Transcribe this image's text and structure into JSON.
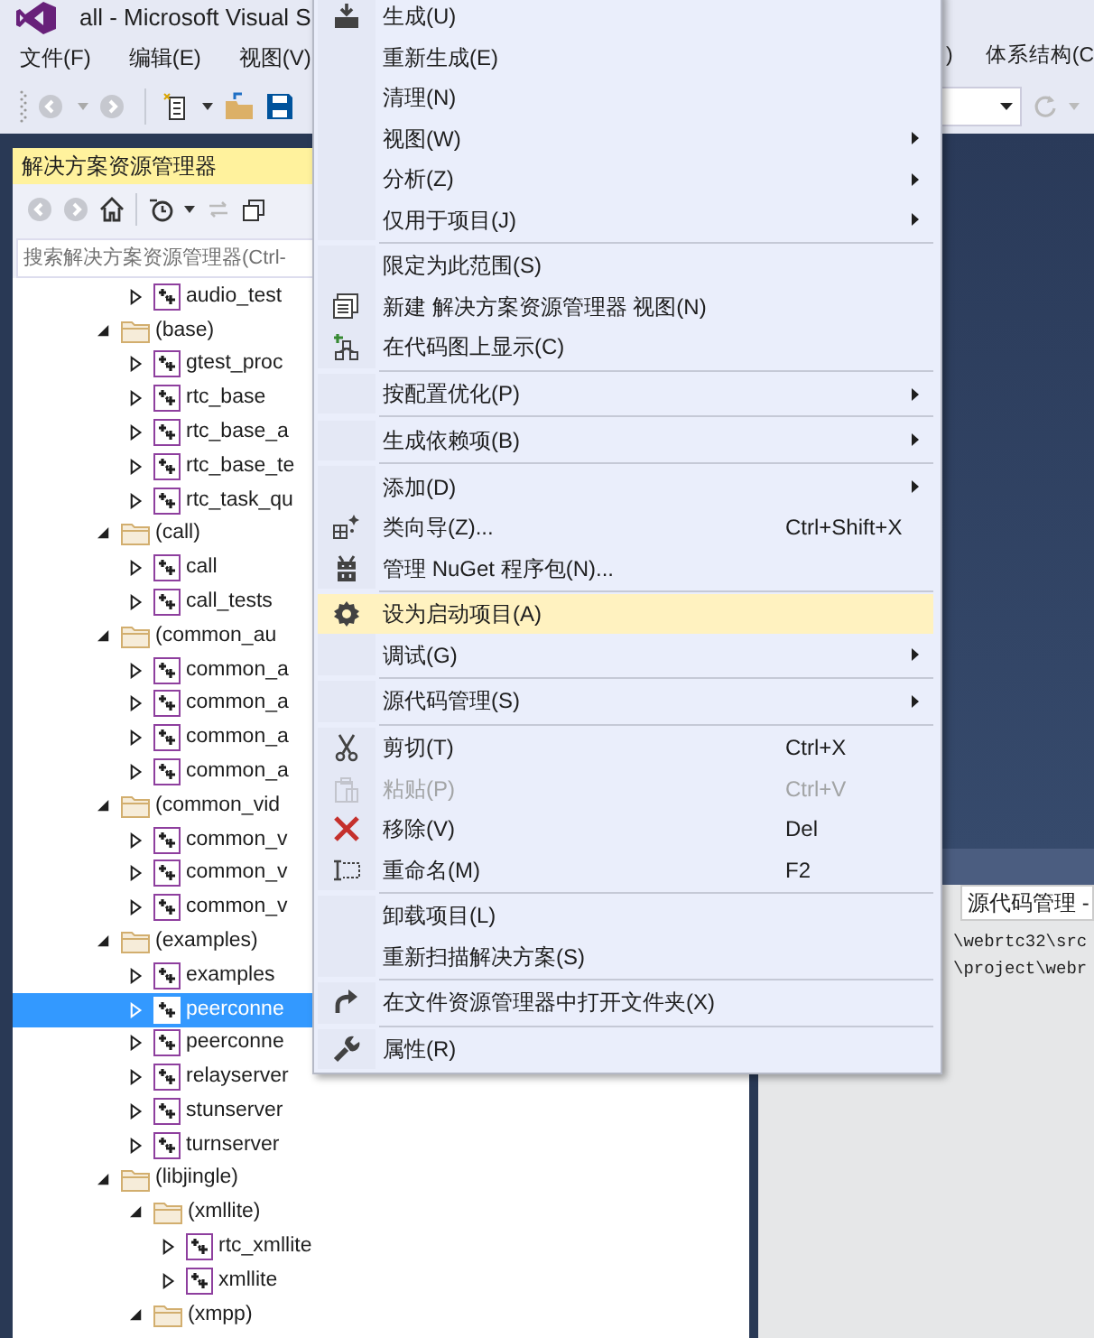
{
  "window": {
    "title": "all - Microsoft Visual S"
  },
  "menu_bar": {
    "items": [
      "文件(F)",
      "编辑(E)",
      "视图(V)"
    ],
    "right_items": [
      ")",
      "体系结构(C"
    ]
  },
  "solution_explorer": {
    "title": "解决方案资源管理器",
    "search": {
      "placeholder": "搜索解决方案资源管理器(Ctrl-"
    },
    "tree": {
      "continued": [
        {
          "label": "audio_test",
          "kind": "project",
          "expanded": false,
          "selected": false
        }
      ],
      "items": [
        {
          "label": "(base)",
          "kind": "folder",
          "expanded": true,
          "selected": false,
          "children": [
            {
              "label": "gtest_proc",
              "kind": "project",
              "expanded": false,
              "selected": false
            },
            {
              "label": "rtc_base",
              "kind": "project",
              "expanded": false,
              "selected": false
            },
            {
              "label": "rtc_base_a",
              "kind": "project",
              "expanded": false,
              "selected": false
            },
            {
              "label": "rtc_base_te",
              "kind": "project",
              "expanded": false,
              "selected": false
            },
            {
              "label": "rtc_task_qu",
              "kind": "project",
              "expanded": false,
              "selected": false
            }
          ]
        },
        {
          "label": "(call)",
          "kind": "folder",
          "expanded": true,
          "selected": false,
          "children": [
            {
              "label": "call",
              "kind": "project",
              "expanded": false,
              "selected": false
            },
            {
              "label": "call_tests",
              "kind": "project",
              "expanded": false,
              "selected": false
            }
          ]
        },
        {
          "label": "(common_au",
          "kind": "folder",
          "expanded": true,
          "selected": false,
          "children": [
            {
              "label": "common_a",
              "kind": "project",
              "expanded": false,
              "selected": false
            },
            {
              "label": "common_a",
              "kind": "project",
              "expanded": false,
              "selected": false
            },
            {
              "label": "common_a",
              "kind": "project",
              "expanded": false,
              "selected": false
            },
            {
              "label": "common_a",
              "kind": "project",
              "expanded": false,
              "selected": false
            }
          ]
        },
        {
          "label": "(common_vid",
          "kind": "folder",
          "expanded": true,
          "selected": false,
          "children": [
            {
              "label": "common_v",
              "kind": "project",
              "expanded": false,
              "selected": false
            },
            {
              "label": "common_v",
              "kind": "project",
              "expanded": false,
              "selected": false
            },
            {
              "label": "common_v",
              "kind": "project",
              "expanded": false,
              "selected": false
            }
          ]
        },
        {
          "label": "(examples)",
          "kind": "folder",
          "expanded": true,
          "selected": false,
          "children": [
            {
              "label": "examples",
              "kind": "project",
              "expanded": false,
              "selected": false
            },
            {
              "label": "peerconne",
              "kind": "project",
              "expanded": false,
              "selected": true
            },
            {
              "label": "peerconne",
              "kind": "project",
              "expanded": false,
              "selected": false
            },
            {
              "label": "relayserver",
              "kind": "project",
              "expanded": false,
              "selected": false
            },
            {
              "label": "stunserver",
              "kind": "project",
              "expanded": false,
              "selected": false
            },
            {
              "label": "turnserver",
              "kind": "project",
              "expanded": false,
              "selected": false
            }
          ]
        },
        {
          "label": "(libjingle)",
          "kind": "folder",
          "expanded": true,
          "selected": false,
          "children": [
            {
              "label": "(xmllite)",
              "kind": "folder",
              "expanded": true,
              "selected": false,
              "children": [
                {
                  "label": "rtc_xmllite",
                  "kind": "project",
                  "expanded": false,
                  "selected": false
                },
                {
                  "label": "xmllite",
                  "kind": "project",
                  "expanded": false,
                  "selected": false
                }
              ]
            },
            {
              "label": "(xmpp)",
              "kind": "folder",
              "expanded": true,
              "selected": false
            }
          ]
        }
      ]
    }
  },
  "output": {
    "source": "源代码管理 -",
    "lines": [
      "\\webrtc32\\src",
      "\\project\\webr"
    ]
  },
  "context_menu": {
    "items": [
      {
        "kind": "item",
        "label": "生成(U)",
        "submenu": false,
        "disabled": false,
        "selected": false
      },
      {
        "kind": "item",
        "label": "重新生成(E)",
        "submenu": false,
        "disabled": false,
        "selected": false
      },
      {
        "kind": "item",
        "label": "清理(N)",
        "submenu": false,
        "disabled": false,
        "selected": false
      },
      {
        "kind": "item",
        "label": "视图(W)",
        "submenu": true,
        "disabled": false,
        "selected": false
      },
      {
        "kind": "item",
        "label": "分析(Z)",
        "submenu": true,
        "disabled": false,
        "selected": false
      },
      {
        "kind": "item",
        "label": "仅用于项目(J)",
        "submenu": true,
        "disabled": false,
        "selected": false
      },
      {
        "kind": "separator"
      },
      {
        "kind": "item",
        "label": "限定为此范围(S)",
        "submenu": false,
        "disabled": false,
        "selected": false
      },
      {
        "kind": "item",
        "label": "新建 解决方案资源管理器 视图(N)",
        "submenu": false,
        "disabled": false,
        "selected": false
      },
      {
        "kind": "item",
        "label": "在代码图上显示(C)",
        "submenu": false,
        "disabled": false,
        "selected": false
      },
      {
        "kind": "separator"
      },
      {
        "kind": "item",
        "label": "按配置优化(P)",
        "submenu": true,
        "disabled": false,
        "selected": false
      },
      {
        "kind": "separator"
      },
      {
        "kind": "item",
        "label": "生成依赖项(B)",
        "submenu": true,
        "disabled": false,
        "selected": false
      },
      {
        "kind": "separator"
      },
      {
        "kind": "item",
        "label": "添加(D)",
        "submenu": true,
        "disabled": false,
        "selected": false
      },
      {
        "kind": "item",
        "label": "类向导(Z)...",
        "shortcut": "Ctrl+Shift+X",
        "submenu": false,
        "disabled": false,
        "selected": false
      },
      {
        "kind": "item",
        "label": "管理 NuGet 程序包(N)...",
        "submenu": false,
        "disabled": false,
        "selected": false
      },
      {
        "kind": "separator"
      },
      {
        "kind": "item",
        "label": "设为启动项目(A)",
        "submenu": false,
        "disabled": false,
        "selected": true
      },
      {
        "kind": "item",
        "label": "调试(G)",
        "submenu": true,
        "disabled": false,
        "selected": false
      },
      {
        "kind": "separator"
      },
      {
        "kind": "item",
        "label": "源代码管理(S)",
        "submenu": true,
        "disabled": false,
        "selected": false
      },
      {
        "kind": "separator"
      },
      {
        "kind": "item",
        "label": "剪切(T)",
        "shortcut": "Ctrl+X",
        "submenu": false,
        "disabled": false,
        "selected": false
      },
      {
        "kind": "item",
        "label": "粘贴(P)",
        "shortcut": "Ctrl+V",
        "submenu": false,
        "disabled": true,
        "selected": false
      },
      {
        "kind": "item",
        "label": "移除(V)",
        "shortcut": "Del",
        "submenu": false,
        "disabled": false,
        "selected": false
      },
      {
        "kind": "item",
        "label": "重命名(M)",
        "shortcut": "F2",
        "submenu": false,
        "disabled": false,
        "selected": false
      },
      {
        "kind": "separator"
      },
      {
        "kind": "item",
        "label": "卸载项目(L)",
        "submenu": false,
        "disabled": false,
        "selected": false
      },
      {
        "kind": "item",
        "label": "重新扫描解决方案(S)",
        "submenu": false,
        "disabled": false,
        "selected": false
      },
      {
        "kind": "separator"
      },
      {
        "kind": "item",
        "label": "在文件资源管理器中打开文件夹(X)",
        "submenu": false,
        "disabled": false,
        "selected": false
      },
      {
        "kind": "separator"
      },
      {
        "kind": "item",
        "label": "属性(R)",
        "submenu": false,
        "disabled": false,
        "selected": false
      }
    ]
  }
}
